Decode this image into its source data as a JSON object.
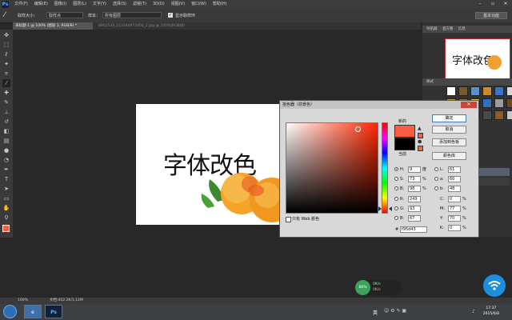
{
  "app": {
    "logo": "Ps",
    "menu": [
      "文件(F)",
      "编辑(E)",
      "图像(I)",
      "图层(L)",
      "文字(Y)",
      "选择(S)",
      "滤镜(T)",
      "3D(D)",
      "视图(V)",
      "窗口(W)",
      "帮助(H)"
    ]
  },
  "options": {
    "sample_size_label": "取样大小：",
    "sample_size_value": "取样点",
    "sample_label": "样本：",
    "sample_value": "所有图层",
    "show_ring_label": "显示取样环",
    "workspace": "基本功能"
  },
  "tabs": [
    {
      "label": "未标题-1 @ 100% (图层 1, RGB/8) *"
    },
    {
      "label": "8952533_213244975000_2.jpg @ 100%(RGB/8)"
    }
  ],
  "canvas_text": "字体改色",
  "right_panel": {
    "navigator_tab": "导航器",
    "histogram_tab": "直方图",
    "info_tab": "信息",
    "styles_tab": "样式",
    "navigator_text": "字体改色",
    "opacity_label": "透明度",
    "fill_label": "填充"
  },
  "picker": {
    "title": "拾色器（前景色）",
    "new_label": "新的",
    "current_label": "当前",
    "buttons": {
      "ok": "确定",
      "cancel": "取消",
      "add_swatch": "添加到色板",
      "libraries": "颜色库"
    },
    "web_only": "只有 Web 颜色",
    "fields": {
      "H": "9",
      "H_unit": "度",
      "S": "73",
      "S_unit": "%",
      "B": "98",
      "B_unit": "%",
      "R": "249",
      "G": "93",
      "Bl": "67",
      "L": "61",
      "a": "60",
      "b": "48",
      "C": "0",
      "M": "77",
      "Y": "70",
      "K": "0",
      "hex": "f95d43"
    },
    "new_color": "#f95d43",
    "current_color": "#000000"
  },
  "status": {
    "zoom": "100%",
    "doc": "文档:452.2K/1.12M"
  },
  "taskbar": {
    "ps_label": "Ps",
    "time": "17:37",
    "date": "2015/6/8",
    "ime": "英"
  },
  "netwidget": {
    "pct": "86%",
    "up": "0K/s",
    "down": "0K/s"
  }
}
